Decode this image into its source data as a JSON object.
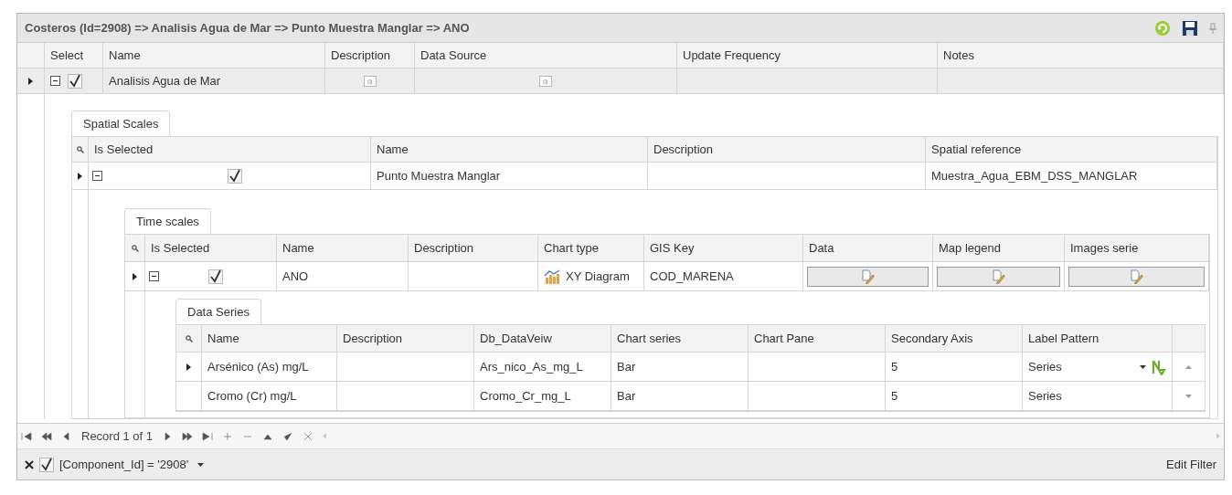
{
  "title": "Costeros (Id=2908) => Analisis Agua de Mar => Punto Muestra Manglar => ANO",
  "components": {
    "columns": [
      "Select",
      "Name",
      "Description",
      "Data Source",
      "Update Frequency",
      "Notes"
    ],
    "rows": [
      {
        "focused": true,
        "expanded": true,
        "checked": true,
        "name": "Analisis Agua de Mar"
      }
    ]
  },
  "spatial_scales": {
    "tab": "Spatial Scales",
    "columns": [
      "Is Selected",
      "Name",
      "Description",
      "Spatial reference"
    ],
    "rows": [
      {
        "focused": true,
        "expanded": true,
        "checked": true,
        "name": "Punto Muestra Manglar",
        "spatial_reference": "Muestra_Agua_EBM_DSS_MANGLAR"
      }
    ]
  },
  "time_scales": {
    "tab": "Time scales",
    "columns": [
      "Is Selected",
      "Name",
      "Description",
      "Chart type",
      "GIS Key",
      "Data",
      "Map legend",
      "Images serie"
    ],
    "rows": [
      {
        "focused": true,
        "expanded": true,
        "checked": true,
        "name": "ANO",
        "chart_type": "XY Diagram",
        "gis_key": "COD_MARENA"
      }
    ]
  },
  "data_series": {
    "tab": "Data Series",
    "columns": [
      "Name",
      "Description",
      "Db_DataVeiw",
      "Chart series",
      "Chart Pane",
      "Secondary Axis",
      "Label Pattern"
    ],
    "rows": [
      {
        "focused": true,
        "editing": true,
        "name": "Arsénico (As) mg/L",
        "db_dataview": "Ars_nico_As_mg_L",
        "chart_series": "Bar",
        "secondary_axis": "5",
        "label_pattern": "Series"
      },
      {
        "focused": false,
        "editing": false,
        "name": "Cromo (Cr) mg/L",
        "db_dataview": "Cromo_Cr_mg_L",
        "chart_series": "Bar",
        "secondary_axis": "5",
        "label_pattern": "Series"
      }
    ]
  },
  "navigator": {
    "record": "Record 1 of 1"
  },
  "filter": {
    "enabled": true,
    "expression": "[Component_Id] = '2908'",
    "edit_label": "Edit Filter"
  }
}
